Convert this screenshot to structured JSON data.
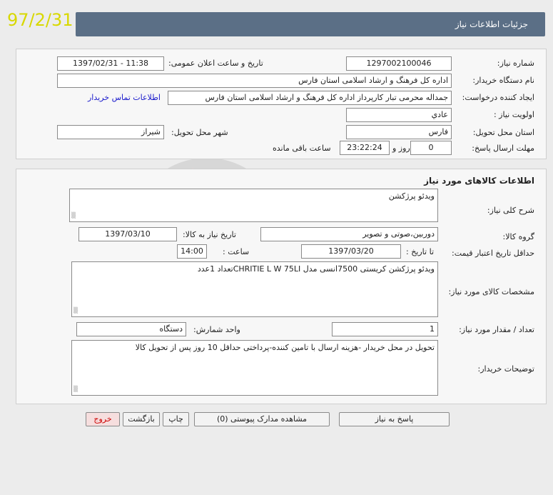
{
  "overlay": {
    "date_stamp": "97/2/31"
  },
  "header": {
    "title": "جزئیات اطلاعات نیاز"
  },
  "need_info": {
    "need_number_label": "شماره نیاز:",
    "need_number": "1297002100046",
    "announce_label": "تاریخ و ساعت اعلان عمومی:",
    "announce_value": "1397/02/31 - 11:38",
    "buyer_label": "نام دستگاه خریدار:",
    "buyer_value": "اداره کل فرهنگ و ارشاد اسلامی استان فارس",
    "creator_label": "ایجاد کننده درخواست:",
    "creator_value": "جمداله محرمی تبار کارپرداز اداره کل فرهنگ و ارشاد اسلامی استان فارس",
    "contact_link": "اطلاعات تماس خریدار",
    "priority_label": "اولویت نیاز :",
    "priority_value": "عادي",
    "province_label": "استان محل تحویل:",
    "province_value": "فارس",
    "city_label": "شهر محل تحویل:",
    "city_value": "شیراز",
    "deadline_label": "مهلت ارسال پاسخ:",
    "days_value": "0",
    "days_label": "روز و",
    "time_value": "23:22:24",
    "remaining_label": "ساعت باقی مانده"
  },
  "goods": {
    "section_title": "اطلاعات کالاهای مورد نیاز",
    "desc_label": "شرح کلی نیاز:",
    "desc_value": "ویدئو پرژکشن",
    "group_label": "گروه کالا:",
    "group_value": "دوربین،صوتی و تصویر",
    "need_date_label": "تاریخ نیاز به کالا:",
    "need_date_value": "1397/03/10",
    "price_valid_label": "حداقل تاریخ اعتبار قیمت:",
    "until_label": "تا تاریخ :",
    "until_value": "1397/03/20",
    "hour_label": "ساعت :",
    "hour_value": "14:00",
    "specs_label": "مشخصات کالای مورد نیاز:",
    "specs_value": "ویدئو پرژکشن کریستی 7500انسی  مدل CHRITIE L W  75LIتعداد 1عدد",
    "qty_label": "تعداد / مقدار مورد نیاز:",
    "qty_value": "1",
    "unit_label": "واحد شمارش:",
    "unit_value": "دستگاه",
    "buyer_notes_label": "توضیحات خریدار:",
    "buyer_notes_value": "تحویل در محل خریدار -هزینه ارسال با تامین کننده-پرداختی حداقل 10 روز پس از تحویل کالا"
  },
  "actions": {
    "respond": "پاسخ به نیاز",
    "view_attachments": "مشاهده مدارک پیوستی (0)",
    "print": "چاپ",
    "back": "بازگشت",
    "exit": "خروج"
  },
  "colors": {
    "header_bg": "#5b6f86",
    "stamp": "#d8d800",
    "link": "#1a1acc",
    "exit_text": "#cc0000"
  }
}
